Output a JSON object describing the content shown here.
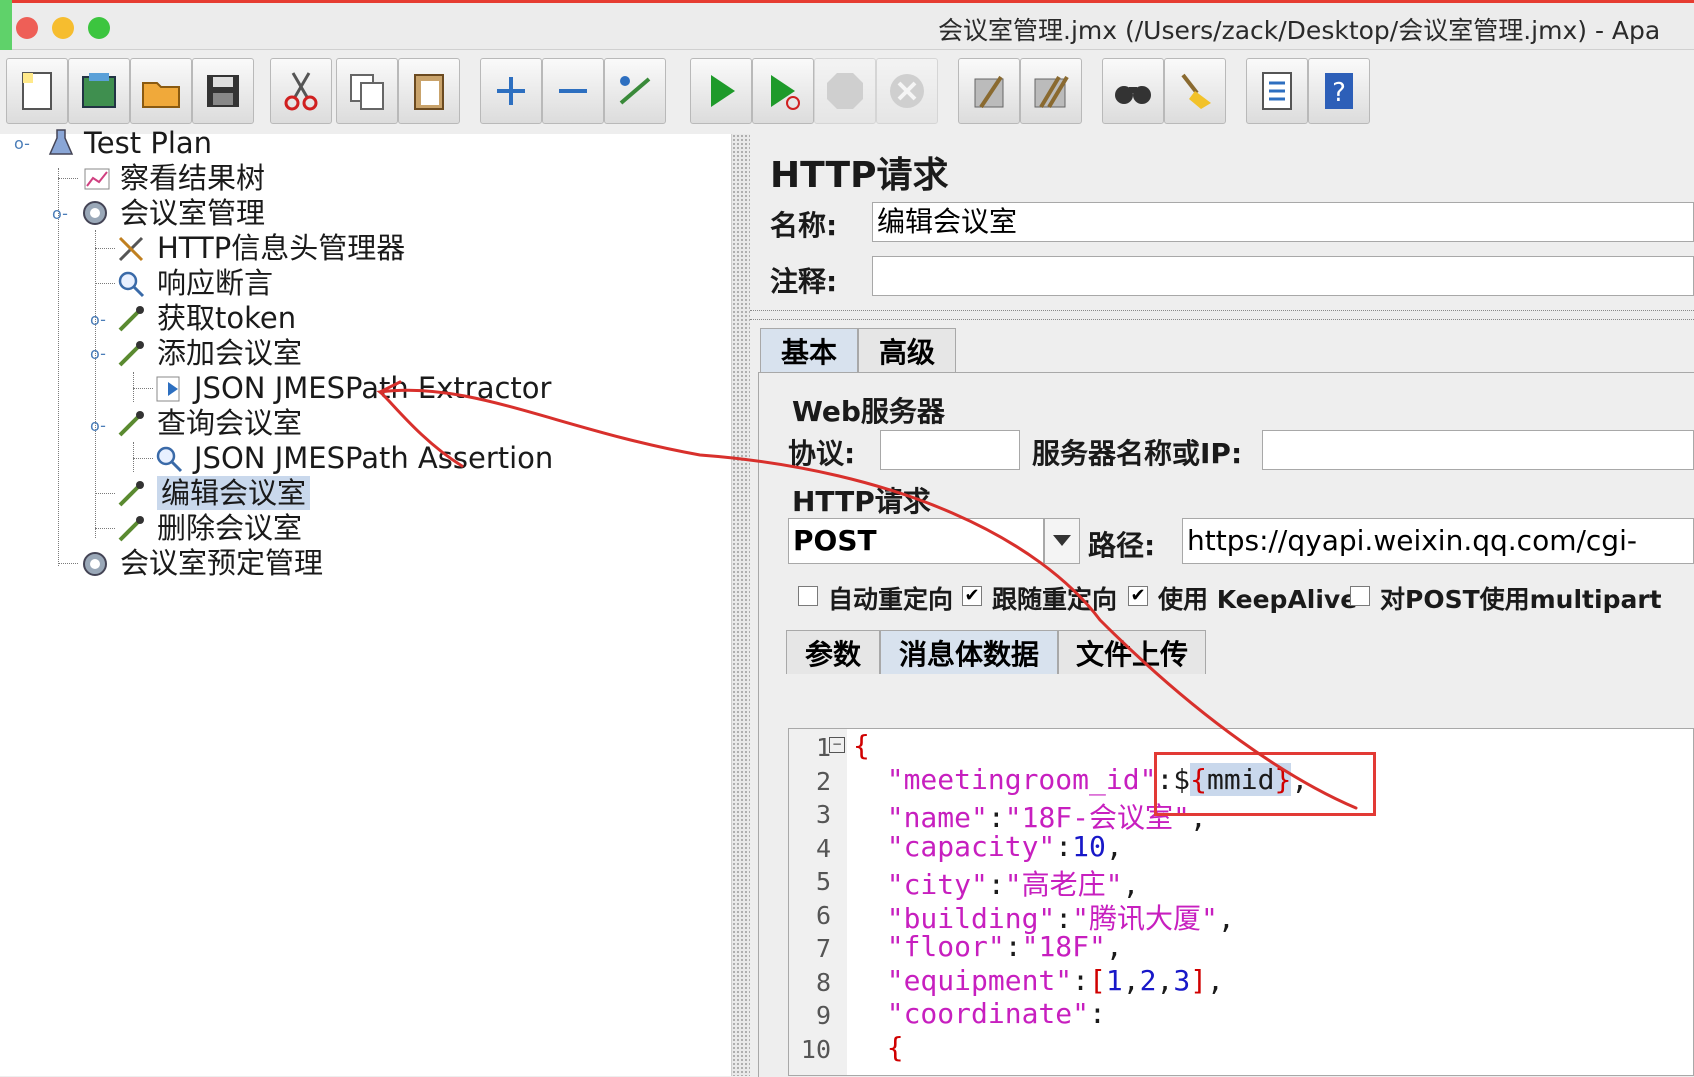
{
  "window": {
    "title": "会议室管理.jmx (/Users/zack/Desktop/会议室管理.jmx) - Apa"
  },
  "toolbar": {
    "buttons": [
      {
        "icon": "new-icon"
      },
      {
        "icon": "templates-icon"
      },
      {
        "icon": "open-icon"
      },
      {
        "icon": "save-icon"
      },
      {
        "icon": "cut-icon"
      },
      {
        "icon": "copy-icon"
      },
      {
        "icon": "paste-icon"
      },
      {
        "icon": "expand-icon"
      },
      {
        "icon": "collapse-icon"
      },
      {
        "icon": "toggle-icon"
      },
      {
        "icon": "start-icon"
      },
      {
        "icon": "start-no-pause-icon"
      },
      {
        "icon": "stop-icon"
      },
      {
        "icon": "shutdown-icon"
      },
      {
        "icon": "clear-icon"
      },
      {
        "icon": "clear-all-icon"
      },
      {
        "icon": "search-icon"
      },
      {
        "icon": "reset-search-icon"
      },
      {
        "icon": "function-helper-icon"
      },
      {
        "icon": "help-icon"
      }
    ]
  },
  "tree": {
    "items": [
      {
        "label": "Test Plan"
      },
      {
        "label": "察看结果树"
      },
      {
        "label": "会议室管理"
      },
      {
        "label": "HTTP信息头管理器"
      },
      {
        "label": "响应断言"
      },
      {
        "label": "获取token"
      },
      {
        "label": "添加会议室"
      },
      {
        "label": "JSON JMESPath Extractor"
      },
      {
        "label": "查询会议室"
      },
      {
        "label": "JSON JMESPath Assertion"
      },
      {
        "label": "编辑会议室"
      },
      {
        "label": "删除会议室"
      },
      {
        "label": "会议室预定管理"
      }
    ]
  },
  "panel": {
    "title": "HTTP请求",
    "name_label": "名称:",
    "name_value": "编辑会议室",
    "comment_label": "注释:",
    "comment_value": "",
    "tabs": [
      "基本",
      "高级"
    ],
    "web_server": {
      "section": "Web服务器",
      "protocol_label": "协议:",
      "protocol_value": "",
      "server_label": "服务器名称或IP:",
      "server_value": ""
    },
    "http_request": {
      "section": "HTTP请求",
      "method": "POST",
      "path_label": "路径:",
      "path_value": "https://qyapi.weixin.qq.com/cgi-"
    },
    "checkboxes": [
      {
        "label": "自动重定向",
        "checked": false
      },
      {
        "label": "跟随重定向",
        "checked": true
      },
      {
        "label": "使用 KeepAlive",
        "checked": true
      },
      {
        "label": "对POST使用multipart",
        "checked": false
      }
    ],
    "body_tabs": [
      "参数",
      "消息体数据",
      "文件上传"
    ]
  },
  "editor": {
    "line_numbers": [
      "1",
      "2",
      "3",
      "4",
      "5",
      "6",
      "7",
      "8",
      "9",
      "10"
    ],
    "lines": {
      "l1": "{",
      "l2_key": "\"meetingroom_id\"",
      "l2_colon": ":",
      "l2_dollar": "$",
      "l2_ob": "{",
      "l2_var": "mmid",
      "l2_cb": "}",
      "l2_comma": ",",
      "l3_key": "\"name\"",
      "l3_val": "\"18F-会议室\"",
      "l4_key": "\"capacity\"",
      "l4_val": "10",
      "l5_key": "\"city\"",
      "l5_val": "\"高老庄\"",
      "l6_key": "\"building\"",
      "l6_val": "\"腾讯大厦\"",
      "l7_key": "\"floor\"",
      "l7_val": "\"18F\"",
      "l8_key": "\"equipment\"",
      "l8_n1": "1",
      "l8_n2": "2",
      "l8_n3": "3",
      "l9_key": "\"coordinate\"",
      "l10": "{"
    }
  },
  "colors": {
    "accent_red": "#e23a35",
    "string": "#c71fbf",
    "number": "#1818c8",
    "selection": "#c9d8ec"
  }
}
